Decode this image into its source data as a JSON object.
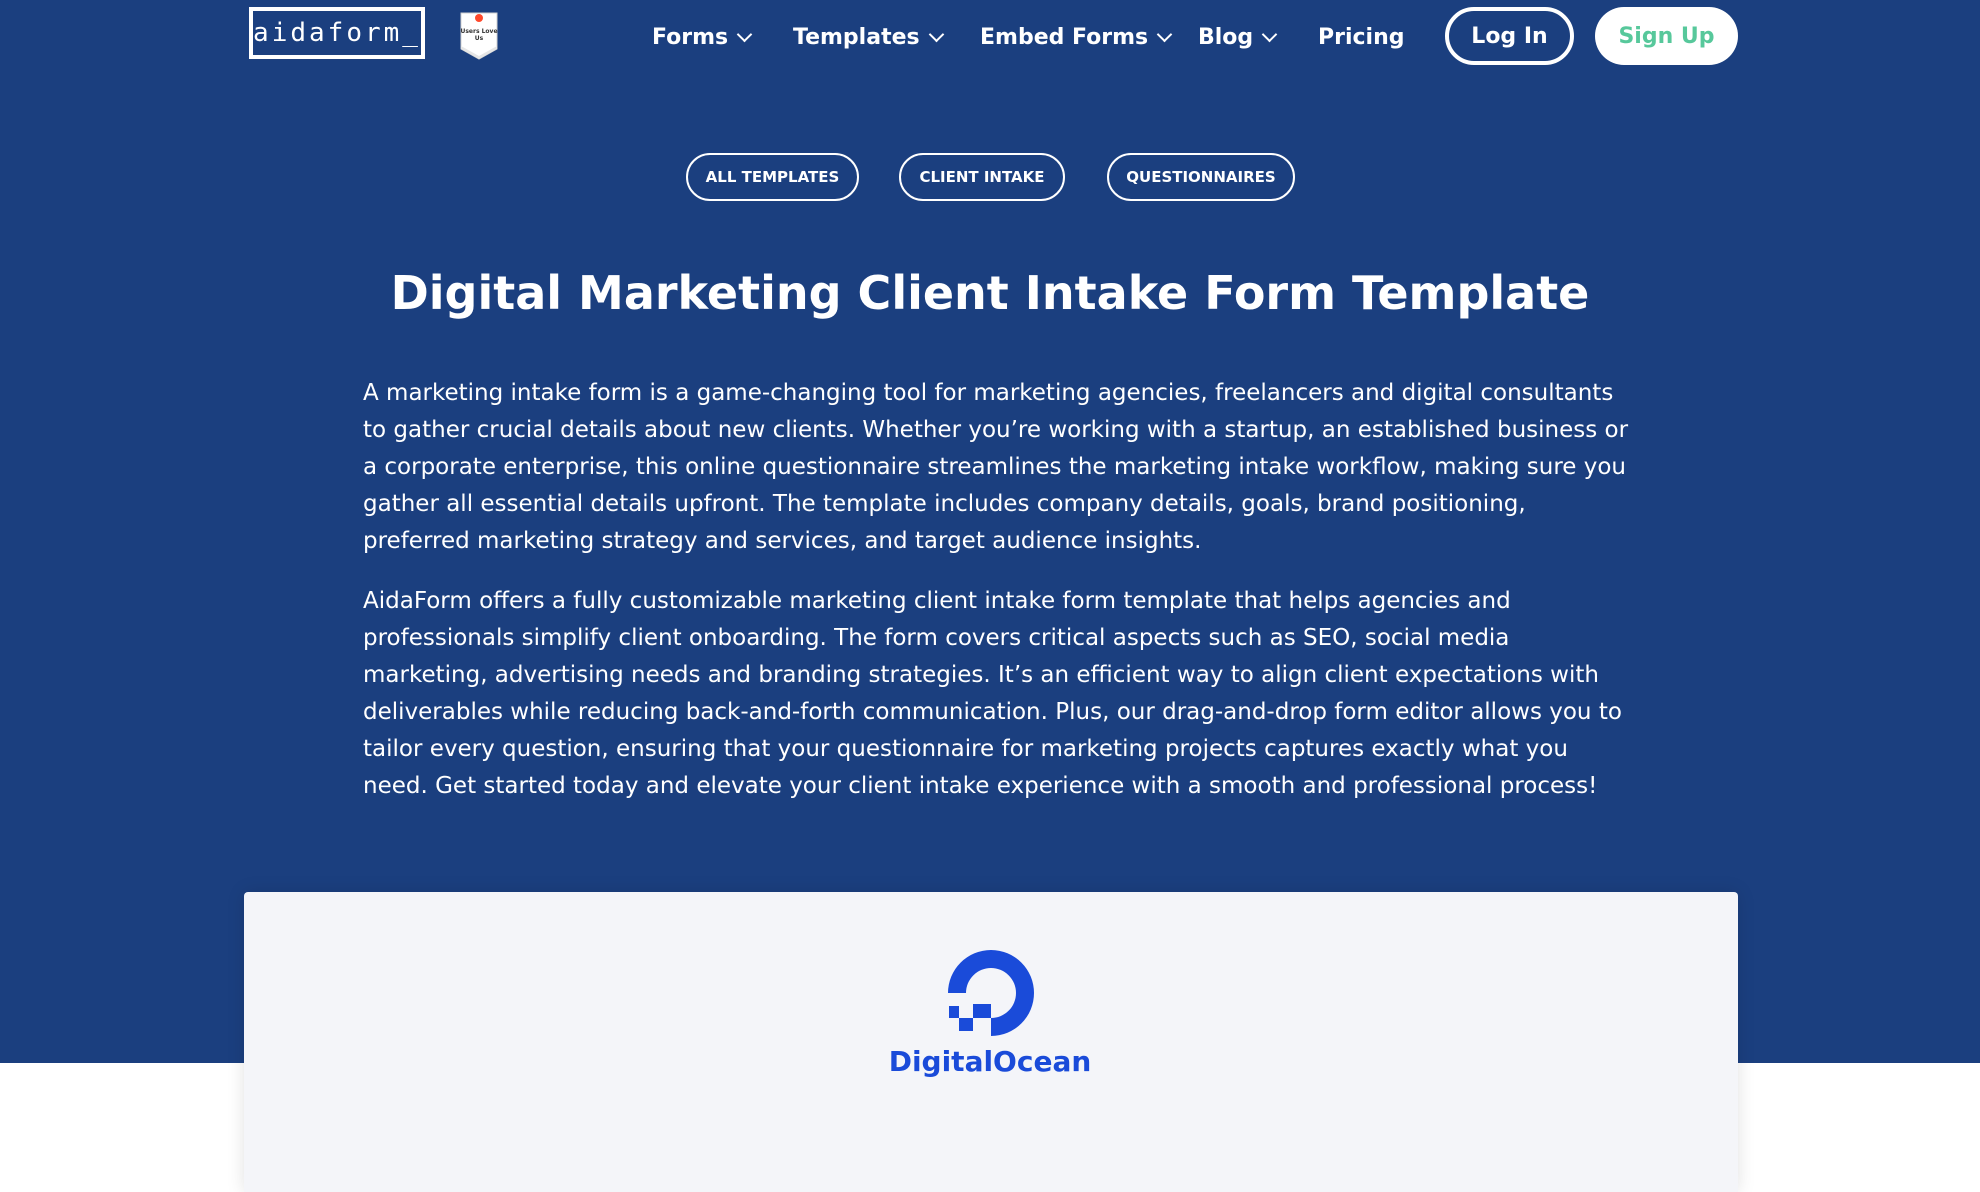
{
  "header": {
    "logo_text": "aidaform_",
    "badge_text": "Users Love Us",
    "nav": [
      {
        "label": "Forms",
        "has_dropdown": true
      },
      {
        "label": "Templates",
        "has_dropdown": true
      },
      {
        "label": "Embed Forms",
        "has_dropdown": true
      },
      {
        "label": "Blog",
        "has_dropdown": true
      },
      {
        "label": "Pricing",
        "has_dropdown": false
      }
    ],
    "login_label": "Log In",
    "signup_label": "Sign Up"
  },
  "categories": [
    {
      "label": "ALL TEMPLATES"
    },
    {
      "label": "CLIENT INTAKE"
    },
    {
      "label": "QUESTIONNAIRES"
    }
  ],
  "main": {
    "title": "Digital Marketing Client Intake Form Template",
    "paragraphs": [
      "A marketing intake form is a game-changing tool for marketing agencies, freelancers and digital consultants to gather crucial details about new clients. Whether you’re working with a startup, an established business or a corporate enterprise, this online questionnaire streamlines the marketing intake workflow, making sure you gather all essential details upfront. The template includes company details, goals, brand positioning, preferred marketing strategy and services, and target audience insights.",
      "AidaForm offers a fully customizable marketing client intake form template that helps agencies and professionals simplify client onboarding. The form covers critical aspects such as SEO, social media marketing, advertising needs and branding strategies. It’s an efficient way to align client expectations with deliverables while reducing back-and-forth communication. Plus, our drag-and-drop form editor allows you to tailor every question, ensuring that your questionnaire for marketing projects captures exactly what you need. Get started today and elevate your client intake experience with a smooth and professional process!"
    ]
  },
  "preview": {
    "brand_name": "DigitalOcean",
    "icon": "digitalocean-logo-icon"
  },
  "colors": {
    "hero_background": "#1b3f7f",
    "signup_text": "#57c89b",
    "brand_blue": "#1a4bd9",
    "card_background": "#f4f5f9"
  }
}
